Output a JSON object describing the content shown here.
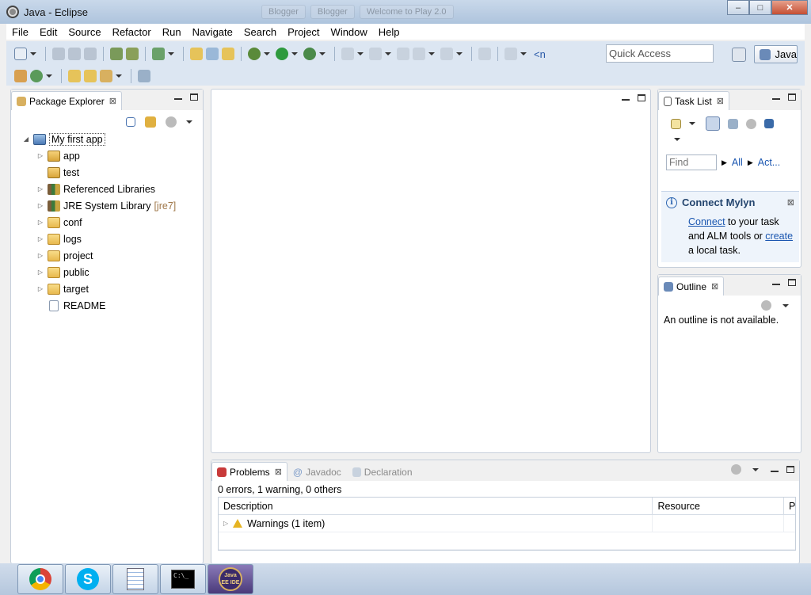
{
  "window": {
    "title": "Java - Eclipse",
    "background_tabs": [
      "Blogger",
      "Blogger",
      "Welcome to Play 2.0"
    ],
    "controls": {
      "minimize": "–",
      "maximize": "□",
      "close": "✕"
    }
  },
  "menubar": {
    "items": [
      "File",
      "Edit",
      "Source",
      "Refactor",
      "Run",
      "Navigate",
      "Search",
      "Project",
      "Window",
      "Help"
    ]
  },
  "toolbar": {
    "quick_access_placeholder": "Quick Access",
    "perspective_label": "Java",
    "nav_text": "<n"
  },
  "package_explorer": {
    "tab_label": "Package Explorer",
    "close_glyph": "⊠",
    "project": "My first app",
    "items": [
      {
        "label": "app",
        "icon": "package-folder-icon"
      },
      {
        "label": "test",
        "icon": "package-folder-icon"
      },
      {
        "label": "Referenced Libraries",
        "icon": "library-icon"
      },
      {
        "label": "JRE System Library",
        "hint": "[jre7]",
        "icon": "library-icon"
      },
      {
        "label": "conf",
        "icon": "folder-icon"
      },
      {
        "label": "logs",
        "icon": "folder-icon"
      },
      {
        "label": "project",
        "icon": "folder-icon"
      },
      {
        "label": "public",
        "icon": "folder-icon"
      },
      {
        "label": "target",
        "icon": "folder-icon"
      },
      {
        "label": "README",
        "icon": "file-icon"
      }
    ]
  },
  "task_list": {
    "tab_label": "Task List",
    "find_placeholder": "Find",
    "filter_all": "All",
    "filter_activate": "Act...",
    "mylyn": {
      "title": "Connect Mylyn",
      "connect_link": "Connect",
      "text1": " to your task and ALM tools or ",
      "create_link": "create",
      "text2": " a local task."
    }
  },
  "outline": {
    "tab_label": "Outline",
    "message": "An outline is not available."
  },
  "problems": {
    "tabs": [
      "Problems",
      "Javadoc",
      "Declaration"
    ],
    "summary": "0 errors, 1 warning, 0 others",
    "columns": [
      "Description",
      "Resource",
      "Pa"
    ],
    "rows": [
      {
        "description": "Warnings (1 item)",
        "resource": "",
        "path": ""
      }
    ]
  },
  "taskbar": {
    "apps": [
      "chrome-icon",
      "skype-icon",
      "notepad-icon",
      "command-prompt-icon",
      "java-ee-ide-icon"
    ],
    "java_ee_label": "Java EE IDE",
    "cmd_label": "C:\\_"
  }
}
